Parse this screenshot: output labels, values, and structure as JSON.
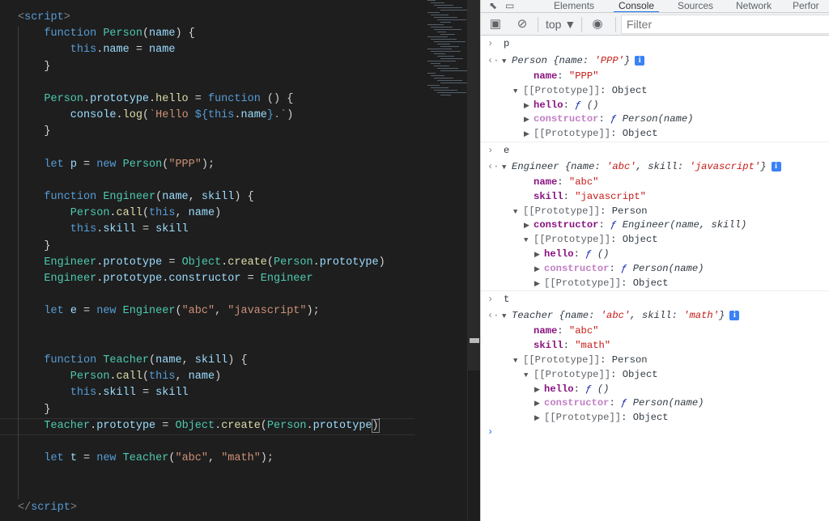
{
  "code": {
    "lines": [
      [
        [
          "t",
          "<"
        ],
        [
          "k",
          "script"
        ],
        [
          "t",
          ">"
        ]
      ],
      [
        [
          "k",
          "    function "
        ],
        [
          "c",
          "Person"
        ],
        [
          "p",
          "("
        ],
        [
          "v",
          "name"
        ],
        [
          "p",
          ") {"
        ]
      ],
      [
        [
          "k",
          "        this"
        ],
        [
          "p",
          "."
        ],
        [
          "v",
          "name"
        ],
        [
          "p",
          " = "
        ],
        [
          "v",
          "name"
        ]
      ],
      [
        [
          "p",
          "    }"
        ]
      ],
      [],
      [
        [
          "c",
          "    Person"
        ],
        [
          "p",
          "."
        ],
        [
          "v",
          "prototype"
        ],
        [
          "p",
          "."
        ],
        [
          "f",
          "hello"
        ],
        [
          "p",
          " = "
        ],
        [
          "k",
          "function"
        ],
        [
          "p",
          " () {"
        ]
      ],
      [
        [
          "v",
          "        console"
        ],
        [
          "p",
          "."
        ],
        [
          "f",
          "log"
        ],
        [
          "p",
          "("
        ],
        [
          "s",
          "`Hello "
        ],
        [
          "k",
          "${"
        ],
        [
          "k",
          "this"
        ],
        [
          "p",
          "."
        ],
        [
          "v",
          "name"
        ],
        [
          "k",
          "}"
        ],
        [
          "s",
          ".`"
        ],
        [
          "p",
          ")"
        ]
      ],
      [
        [
          "p",
          "    }"
        ]
      ],
      [],
      [
        [
          "k",
          "    let "
        ],
        [
          "v",
          "p"
        ],
        [
          "p",
          " = "
        ],
        [
          "k",
          "new "
        ],
        [
          "c",
          "Person"
        ],
        [
          "p",
          "("
        ],
        [
          "s",
          "\"PPP\""
        ],
        [
          "p",
          ");"
        ]
      ],
      [],
      [
        [
          "k",
          "    function "
        ],
        [
          "c",
          "Engineer"
        ],
        [
          "p",
          "("
        ],
        [
          "v",
          "name"
        ],
        [
          "p",
          ", "
        ],
        [
          "v",
          "skill"
        ],
        [
          "p",
          ") {"
        ]
      ],
      [
        [
          "c",
          "        Person"
        ],
        [
          "p",
          "."
        ],
        [
          "f",
          "call"
        ],
        [
          "p",
          "("
        ],
        [
          "k",
          "this"
        ],
        [
          "p",
          ", "
        ],
        [
          "v",
          "name"
        ],
        [
          "p",
          ")"
        ]
      ],
      [
        [
          "k",
          "        this"
        ],
        [
          "p",
          "."
        ],
        [
          "v",
          "skill"
        ],
        [
          "p",
          " = "
        ],
        [
          "v",
          "skill"
        ]
      ],
      [
        [
          "p",
          "    }"
        ]
      ],
      [
        [
          "c",
          "    Engineer"
        ],
        [
          "p",
          "."
        ],
        [
          "v",
          "prototype"
        ],
        [
          "p",
          " = "
        ],
        [
          "c",
          "Object"
        ],
        [
          "p",
          "."
        ],
        [
          "f",
          "create"
        ],
        [
          "p",
          "("
        ],
        [
          "c",
          "Person"
        ],
        [
          "p",
          "."
        ],
        [
          "v",
          "prototype"
        ],
        [
          "p",
          ")"
        ]
      ],
      [
        [
          "c",
          "    Engineer"
        ],
        [
          "p",
          "."
        ],
        [
          "v",
          "prototype"
        ],
        [
          "p",
          "."
        ],
        [
          "v",
          "constructor"
        ],
        [
          "p",
          " = "
        ],
        [
          "c",
          "Engineer"
        ]
      ],
      [],
      [
        [
          "k",
          "    let "
        ],
        [
          "v",
          "e"
        ],
        [
          "p",
          " = "
        ],
        [
          "k",
          "new "
        ],
        [
          "c",
          "Engineer"
        ],
        [
          "p",
          "("
        ],
        [
          "s",
          "\"abc\""
        ],
        [
          "p",
          ", "
        ],
        [
          "s",
          "\"javascript\""
        ],
        [
          "p",
          ");"
        ]
      ],
      [],
      [],
      [
        [
          "k",
          "    function "
        ],
        [
          "c",
          "Teacher"
        ],
        [
          "p",
          "("
        ],
        [
          "v",
          "name"
        ],
        [
          "p",
          ", "
        ],
        [
          "v",
          "skill"
        ],
        [
          "p",
          ") {"
        ]
      ],
      [
        [
          "c",
          "        Person"
        ],
        [
          "p",
          "."
        ],
        [
          "f",
          "call"
        ],
        [
          "p",
          "("
        ],
        [
          "k",
          "this"
        ],
        [
          "p",
          ", "
        ],
        [
          "v",
          "name"
        ],
        [
          "p",
          ")"
        ]
      ],
      [
        [
          "k",
          "        this"
        ],
        [
          "p",
          "."
        ],
        [
          "v",
          "skill"
        ],
        [
          "p",
          " = "
        ],
        [
          "v",
          "skill"
        ]
      ],
      [
        [
          "p",
          "    }"
        ]
      ],
      [
        [
          "c",
          "    Teacher"
        ],
        [
          "p",
          "."
        ],
        [
          "v",
          "prototype"
        ],
        [
          "p",
          " = "
        ],
        [
          "c",
          "Object"
        ],
        [
          "p",
          "."
        ],
        [
          "f",
          "create"
        ],
        [
          "p",
          "("
        ],
        [
          "c",
          "Person"
        ],
        [
          "p",
          "."
        ],
        [
          "v",
          "prototype"
        ],
        [
          "p bm",
          ")"
        ]
      ],
      [],
      [
        [
          "k",
          "    let "
        ],
        [
          "v",
          "t"
        ],
        [
          "p",
          " = "
        ],
        [
          "k",
          "new "
        ],
        [
          "c",
          "Teacher"
        ],
        [
          "p",
          "("
        ],
        [
          "s",
          "\"abc\""
        ],
        [
          "p",
          ", "
        ],
        [
          "s",
          "\"math\""
        ],
        [
          "p",
          ");"
        ]
      ],
      [],
      [],
      [
        [
          "t",
          "</"
        ],
        [
          "k",
          "script"
        ],
        [
          "t",
          ">"
        ]
      ]
    ]
  },
  "devtools": {
    "tabs": [
      "Elements",
      "Console",
      "Sources",
      "Network",
      "Perfor"
    ],
    "active_tab": "Console",
    "context": "top ▼",
    "filter_placeholder": "Filter"
  },
  "console": {
    "rows": [
      {
        "type": "cmd",
        "segs": [
          [
            "",
            "p"
          ]
        ]
      },
      {
        "type": "res",
        "arrow": "down",
        "indent": 0,
        "info": true,
        "segs": [
          [
            "fn",
            "Person "
          ],
          [
            "it",
            "{name: "
          ],
          [
            "str it",
            "'PPP'"
          ],
          [
            "it",
            "}"
          ]
        ]
      },
      {
        "indent": 1,
        "segs": [
          [
            "key",
            "name"
          ],
          [
            "",
            ": "
          ],
          [
            "str",
            "\"PPP\""
          ]
        ]
      },
      {
        "indent": 0,
        "arrow": "down",
        "segs": [
          [
            "gray",
            "[[Prototype]]"
          ],
          [
            "",
            ": Object"
          ]
        ]
      },
      {
        "indent": 1,
        "arrow": "right",
        "segs": [
          [
            "key",
            "hello"
          ],
          [
            "",
            ": "
          ],
          [
            "fsym",
            "ƒ"
          ],
          [
            "it",
            " ()"
          ]
        ]
      },
      {
        "indent": 1,
        "arrow": "right",
        "segs": [
          [
            "keyd",
            "constructor"
          ],
          [
            "",
            ": "
          ],
          [
            "fsym",
            "ƒ"
          ],
          [
            "it",
            " Person(name)"
          ]
        ]
      },
      {
        "indent": 1,
        "arrow": "right",
        "segs": [
          [
            "gray",
            "[[Prototype]]"
          ],
          [
            "",
            ": Object"
          ]
        ]
      },
      {
        "type": "cmd",
        "segs": [
          [
            "",
            "e"
          ]
        ]
      },
      {
        "type": "res",
        "arrow": "down",
        "indent": 0,
        "info": true,
        "segs": [
          [
            "fn",
            "Engineer "
          ],
          [
            "it",
            "{name: "
          ],
          [
            "str it",
            "'abc'"
          ],
          [
            "it",
            ", skill: "
          ],
          [
            "str it",
            "'javascript'"
          ],
          [
            "it",
            "}"
          ]
        ]
      },
      {
        "indent": 1,
        "segs": [
          [
            "key",
            "name"
          ],
          [
            "",
            ": "
          ],
          [
            "str",
            "\"abc\""
          ]
        ]
      },
      {
        "indent": 1,
        "segs": [
          [
            "key",
            "skill"
          ],
          [
            "",
            ": "
          ],
          [
            "str",
            "\"javascript\""
          ]
        ]
      },
      {
        "indent": 0,
        "arrow": "down",
        "segs": [
          [
            "gray",
            "[[Prototype]]"
          ],
          [
            "",
            ": Person"
          ]
        ]
      },
      {
        "indent": 1,
        "arrow": "right",
        "segs": [
          [
            "key",
            "constructor"
          ],
          [
            "",
            ": "
          ],
          [
            "fsym",
            "ƒ"
          ],
          [
            "it",
            " Engineer(name, skill)"
          ]
        ]
      },
      {
        "indent": 1,
        "arrow": "down",
        "segs": [
          [
            "gray",
            "[[Prototype]]"
          ],
          [
            "",
            ": Object"
          ]
        ]
      },
      {
        "indent": 2,
        "arrow": "right",
        "segs": [
          [
            "key",
            "hello"
          ],
          [
            "",
            ": "
          ],
          [
            "fsym",
            "ƒ"
          ],
          [
            "it",
            " ()"
          ]
        ]
      },
      {
        "indent": 2,
        "arrow": "right",
        "segs": [
          [
            "keyd",
            "constructor"
          ],
          [
            "",
            ": "
          ],
          [
            "fsym",
            "ƒ"
          ],
          [
            "it",
            " Person(name)"
          ]
        ]
      },
      {
        "indent": 2,
        "arrow": "right",
        "segs": [
          [
            "gray",
            "[[Prototype]]"
          ],
          [
            "",
            ": Object"
          ]
        ]
      },
      {
        "type": "cmd",
        "segs": [
          [
            "",
            "t"
          ]
        ]
      },
      {
        "type": "res",
        "arrow": "down",
        "indent": 0,
        "info": true,
        "segs": [
          [
            "fn",
            "Teacher "
          ],
          [
            "it",
            "{name: "
          ],
          [
            "str it",
            "'abc'"
          ],
          [
            "it",
            ", skill: "
          ],
          [
            "str it",
            "'math'"
          ],
          [
            "it",
            "}"
          ]
        ]
      },
      {
        "indent": 1,
        "segs": [
          [
            "key",
            "name"
          ],
          [
            "",
            ": "
          ],
          [
            "str",
            "\"abc\""
          ]
        ]
      },
      {
        "indent": 1,
        "segs": [
          [
            "key",
            "skill"
          ],
          [
            "",
            ": "
          ],
          [
            "str",
            "\"math\""
          ]
        ]
      },
      {
        "indent": 0,
        "arrow": "down",
        "segs": [
          [
            "gray",
            "[[Prototype]]"
          ],
          [
            "",
            ": Person"
          ]
        ]
      },
      {
        "indent": 1,
        "arrow": "down",
        "segs": [
          [
            "gray",
            "[[Prototype]]"
          ],
          [
            "",
            ": Object"
          ]
        ]
      },
      {
        "indent": 2,
        "arrow": "right",
        "segs": [
          [
            "key",
            "hello"
          ],
          [
            "",
            ": "
          ],
          [
            "fsym",
            "ƒ"
          ],
          [
            "it",
            " ()"
          ]
        ]
      },
      {
        "indent": 2,
        "arrow": "right",
        "segs": [
          [
            "keyd",
            "constructor"
          ],
          [
            "",
            ": "
          ],
          [
            "fsym",
            "ƒ"
          ],
          [
            "it",
            " Person(name)"
          ]
        ]
      },
      {
        "indent": 2,
        "arrow": "right",
        "segs": [
          [
            "gray",
            "[[Prototype]]"
          ],
          [
            "",
            ": Object"
          ]
        ]
      },
      {
        "type": "prompt",
        "segs": []
      }
    ]
  }
}
